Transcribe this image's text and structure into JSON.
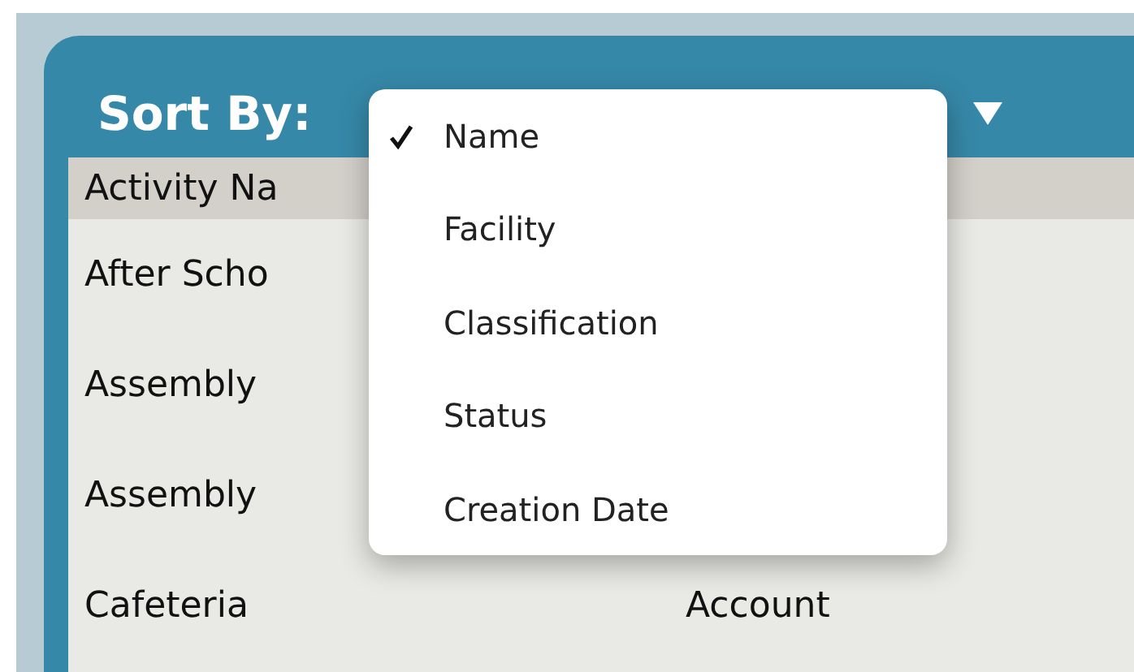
{
  "sort_by": {
    "label": "Sort By:"
  },
  "table": {
    "columns": [
      "Activity Na"
    ],
    "rows": [
      {
        "column_1": "After Scho",
        "column_2": ""
      },
      {
        "column_1": "Assembly"
      },
      {
        "column_1": "Assembly"
      },
      {
        "column_1": "Cafeteria",
        "column_2": "Account"
      }
    ]
  },
  "sort_menu": {
    "items": [
      {
        "label": "Name",
        "selected": true
      },
      {
        "label": "Facility",
        "selected": false
      },
      {
        "label": "Classification",
        "selected": false
      },
      {
        "label": "Status",
        "selected": false
      },
      {
        "label": "Creation Date",
        "selected": false
      }
    ]
  }
}
